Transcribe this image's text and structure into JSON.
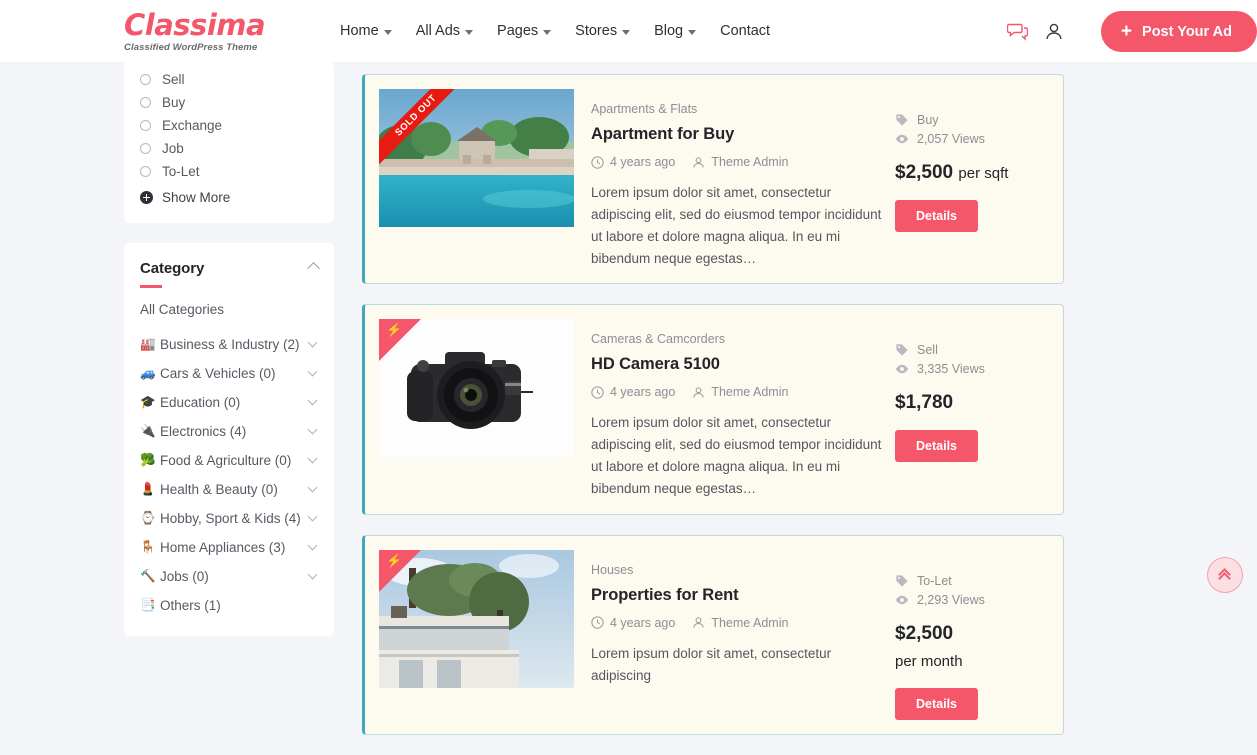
{
  "brand": {
    "name": "Classima",
    "tagline": "Classified WordPress Theme",
    "accent": "#f4566a"
  },
  "header": {
    "nav": [
      {
        "label": "Home",
        "has_dropdown": true
      },
      {
        "label": "All Ads",
        "has_dropdown": true
      },
      {
        "label": "Pages",
        "has_dropdown": true
      },
      {
        "label": "Stores",
        "has_dropdown": true
      },
      {
        "label": "Blog",
        "has_dropdown": true
      },
      {
        "label": "Contact",
        "has_dropdown": false
      }
    ],
    "chat_icon": "chat-bubbles-icon",
    "account_icon": "user-account-icon",
    "post_ad_label": "Post Your Ad",
    "post_ad_plus": "+"
  },
  "sidebar": {
    "ad_type_options": [
      {
        "label": "Sell",
        "selected": false
      },
      {
        "label": "Buy",
        "selected": false
      },
      {
        "label": "Exchange",
        "selected": false
      },
      {
        "label": "Job",
        "selected": false
      },
      {
        "label": "To-Let",
        "selected": false
      }
    ],
    "show_more_label": "Show More",
    "category_panel": {
      "title": "Category",
      "all_label": "All Categories",
      "items": [
        {
          "emoji": "🏭",
          "label": "Business & Industry (2)",
          "expandable": true
        },
        {
          "emoji": "🚙",
          "label": "Cars & Vehicles (0)",
          "expandable": true
        },
        {
          "emoji": "🎓",
          "label": "Education (0)",
          "expandable": true
        },
        {
          "emoji": "🔌",
          "label": "Electronics (4)",
          "expandable": true
        },
        {
          "emoji": "🥦",
          "label": "Food & Agriculture (0)",
          "expandable": true
        },
        {
          "emoji": "💄",
          "label": "Health & Beauty (0)",
          "expandable": true
        },
        {
          "emoji": "⌚",
          "label": "Hobby, Sport & Kids (4)",
          "expandable": true
        },
        {
          "emoji": "🪑",
          "label": "Home Appliances (3)",
          "expandable": true
        },
        {
          "emoji": "🔨",
          "label": "Jobs (0)",
          "expandable": true
        },
        {
          "emoji": "📑",
          "label": "Others (1)",
          "expandable": false
        }
      ]
    }
  },
  "listings": [
    {
      "badge": "SOLD OUT",
      "badge_type": "sold-out",
      "image": "apartment-pool-villa",
      "category": "Apartments & Flats",
      "title": "Apartment for Buy",
      "time_ago": "4 years ago",
      "author": "Theme Admin",
      "description": "Lorem ipsum dolor sit amet, consectetur adipiscing elit, sed do eiusmod tempor incididunt ut labore et dolore magna aliqua. In eu mi bibendum neque egestas…",
      "ad_type": "Buy",
      "views": "2,057 Views",
      "price": "$2,500",
      "price_unit": "per sqft",
      "details_label": "Details"
    },
    {
      "badge": "featured",
      "badge_type": "featured",
      "image": "dslr-camera",
      "category": "Cameras & Camcorders",
      "title": "HD Camera 5100",
      "time_ago": "4 years ago",
      "author": "Theme Admin",
      "description": "Lorem ipsum dolor sit amet, consectetur adipiscing elit, sed do eiusmod tempor incididunt ut labore et dolore magna aliqua. In eu mi bibendum neque egestas…",
      "ad_type": "Sell",
      "views": "3,335 Views",
      "price": "$1,780",
      "price_unit": "",
      "details_label": "Details"
    },
    {
      "badge": "featured",
      "badge_type": "featured",
      "image": "modern-house",
      "category": "Houses",
      "title": "Properties for Rent",
      "time_ago": "4 years ago",
      "author": "Theme Admin",
      "description": "Lorem ipsum dolor sit amet, consectetur adipiscing",
      "ad_type": "To-Let",
      "views": "2,293 Views",
      "price": "$2,500",
      "price_unit": "per month",
      "details_label": "Details"
    }
  ],
  "scroll_top": {
    "icon": "double-chevron-up-icon"
  }
}
